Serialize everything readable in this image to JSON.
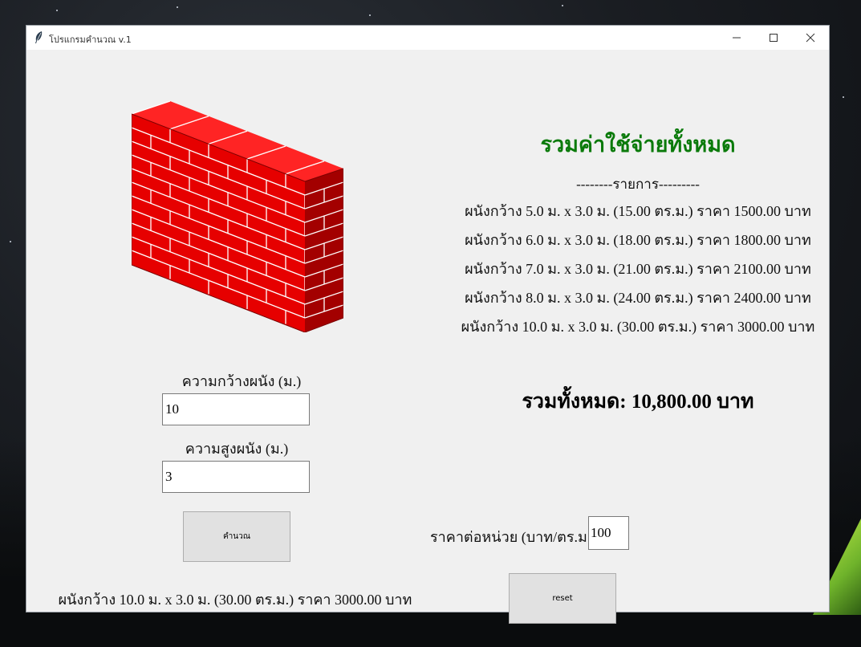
{
  "window": {
    "title": "โปรแกรมคำนวณ v.1",
    "controls": [
      "minimize-icon",
      "maximize-icon",
      "close-icon"
    ]
  },
  "form": {
    "width_label": "ความกว้างผนัง (ม.)",
    "width_value": "10",
    "height_label": "ความสูงผนัง (ม.)",
    "height_value": "3",
    "calculate_label": "คำนวณ",
    "result_line": "ผนังกว้าง 10.0 ม. x 3.0 ม. (30.00 ตร.ม.) ราคา 3000.00 บาท"
  },
  "summary": {
    "title": "รวมค่าใช้จ่ายทั้งหมด",
    "list_header": "--------รายการ---------",
    "items": [
      "ผนังกว้าง 5.0 ม. x 3.0 ม. (15.00 ตร.ม.) ราคา 1500.00 บาท",
      "ผนังกว้าง 6.0 ม. x 3.0 ม. (18.00 ตร.ม.) ราคา 1800.00 บาท",
      "ผนังกว้าง 7.0 ม. x 3.0 ม. (21.00 ตร.ม.) ราคา 2100.00 บาท",
      "ผนังกว้าง 8.0 ม. x 3.0 ม. (24.00 ตร.ม.) ราคา 2400.00 บาท",
      "ผนังกว้าง 10.0 ม. x 3.0 ม. (30.00 ตร.ม.) ราคา 3000.00 บาท"
    ],
    "total": "รวมทั้งหมด: 10,800.00 บาท",
    "unit_price_label": "ราคาต่อหน่วย (บาท/ตร.ม.)",
    "unit_price_value": "100",
    "reset_label": "reset"
  },
  "colors": {
    "summary_title": "#0a7a0a",
    "brick": "#e60000",
    "brick_top": "#ff2020",
    "brick_side": "#a30000",
    "mortar": "#ffffff"
  },
  "icons": {
    "app": "feather-icon",
    "image": "brick-wall-image"
  }
}
